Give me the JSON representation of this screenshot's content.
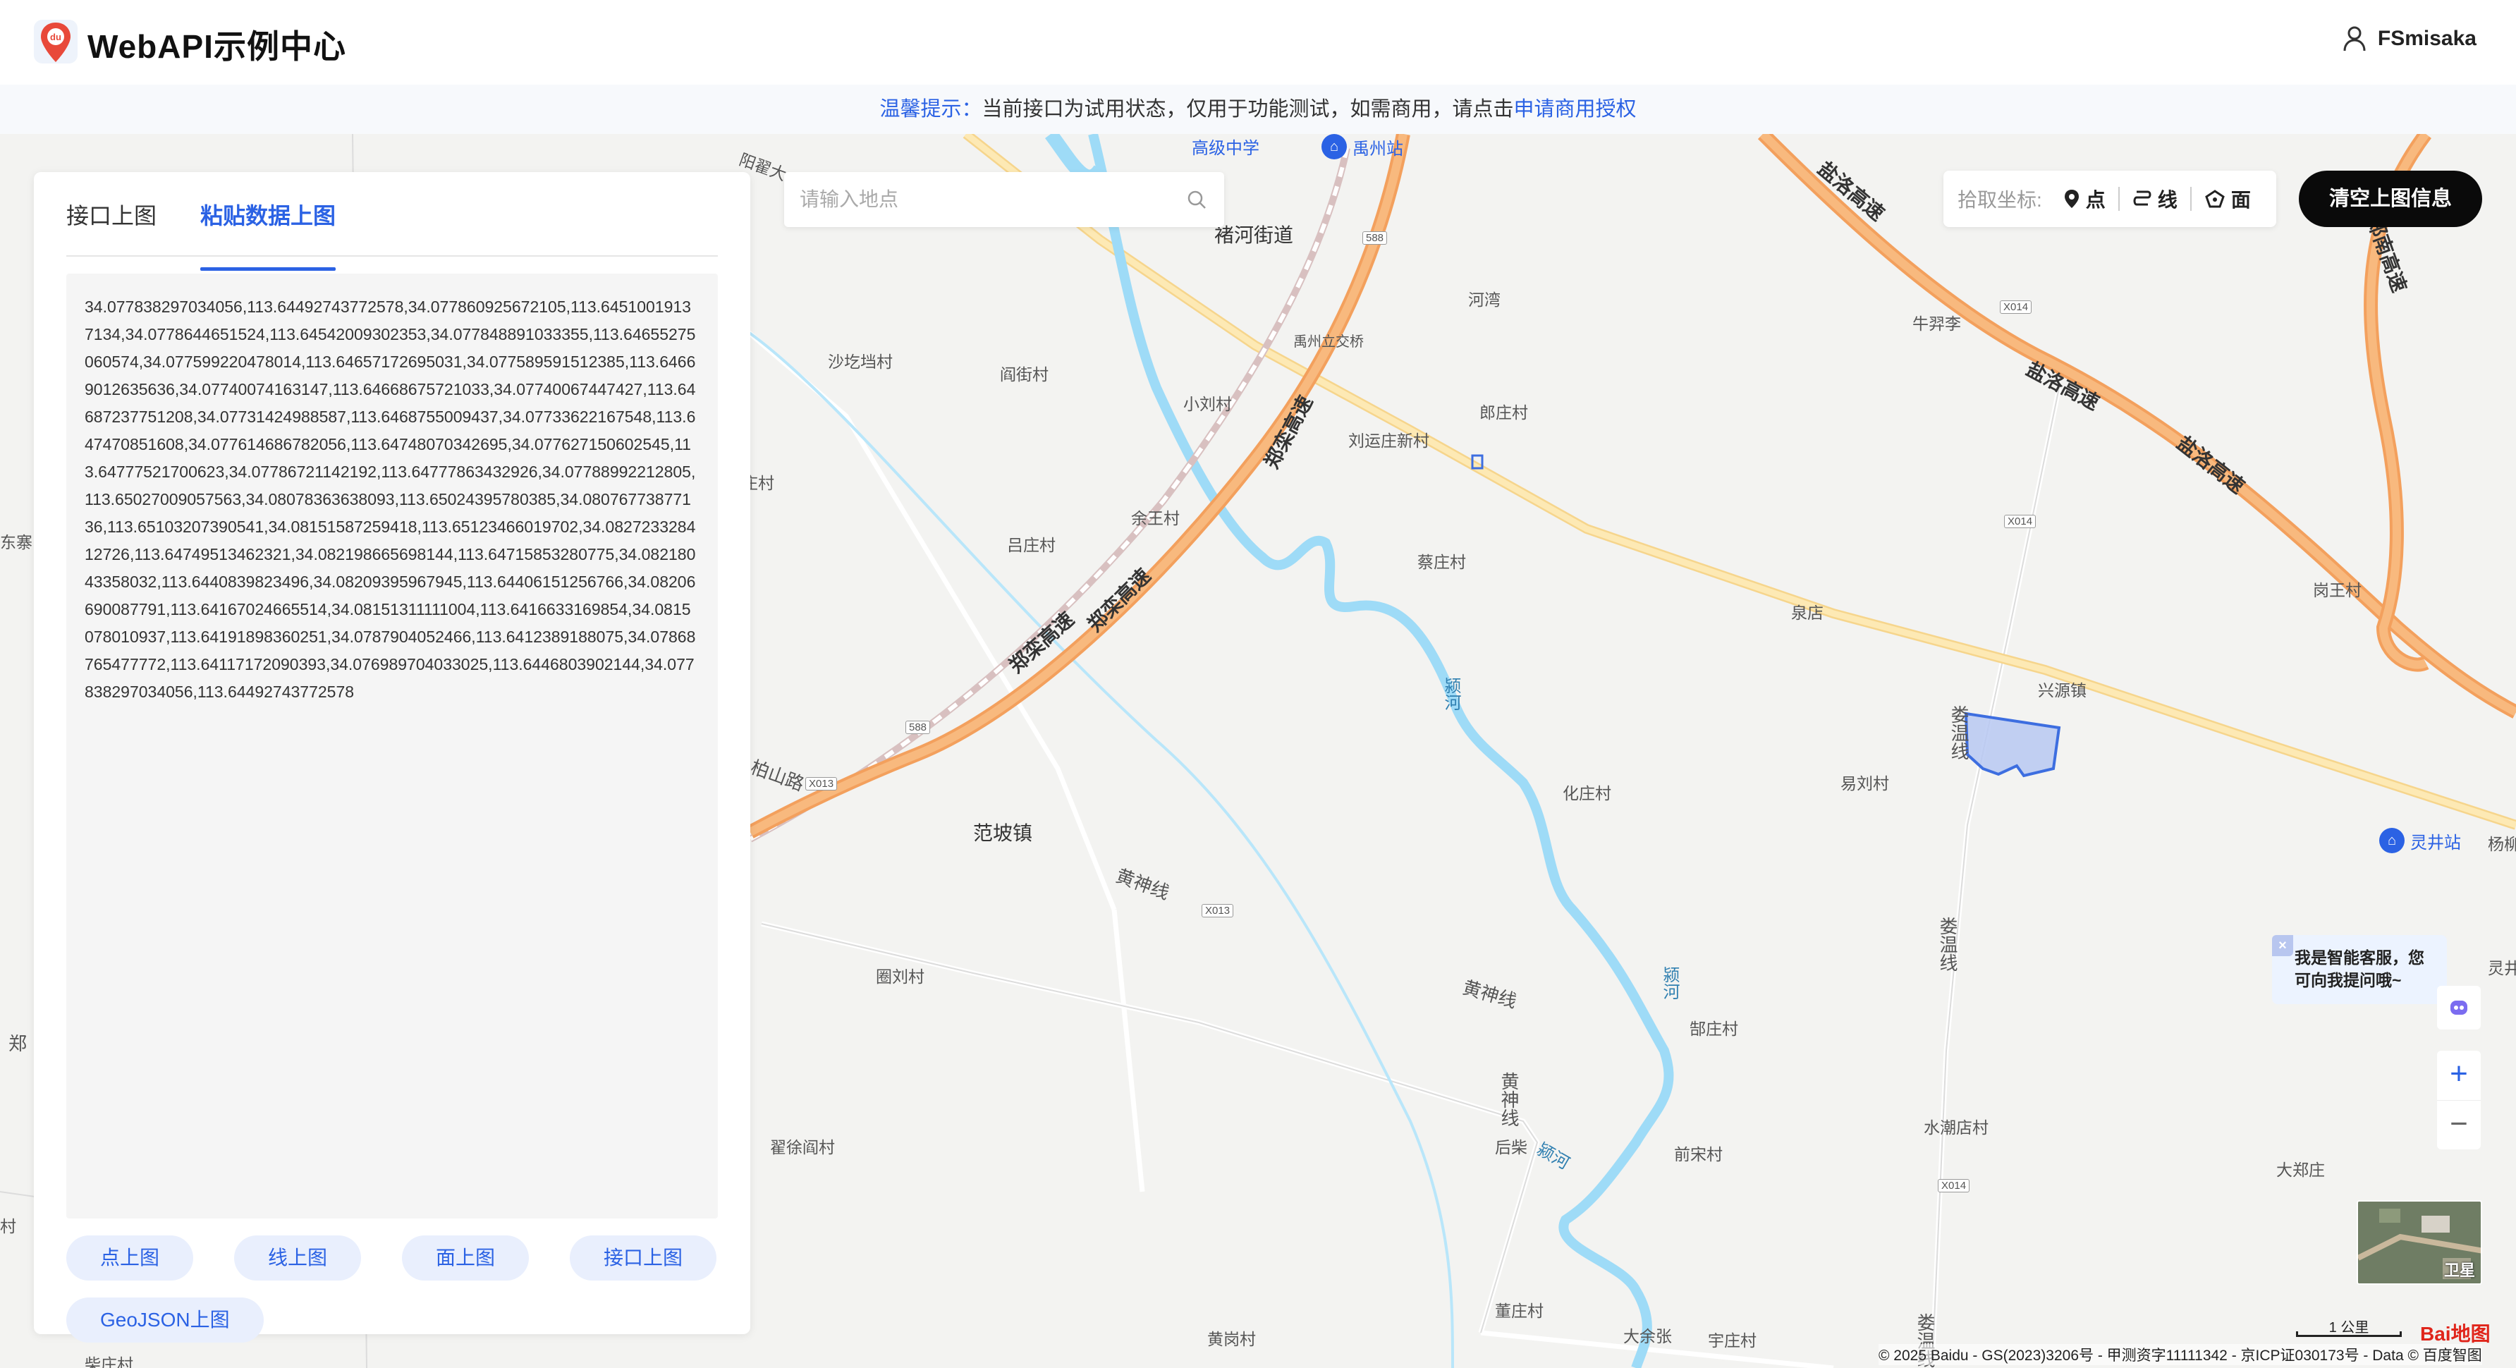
{
  "header": {
    "brand": "WebAPI示例中心",
    "user": "FSmisaka"
  },
  "notice": {
    "prefix": "温馨提示：",
    "text": "当前接口为试用状态，仅用于功能测试，如需商用，请点击",
    "link": "申请商用授权"
  },
  "panel": {
    "tabs": [
      {
        "label": "接口上图",
        "active": false
      },
      {
        "label": "粘贴数据上图",
        "active": true
      }
    ],
    "textarea_value": "34.077838297034056,113.64492743772578,34.077860925672105,113.64510019137134,34.0778644651524,113.64542009302353,34.077848891033355,113.64655275060574,34.077599220478014,113.64657172695031,34.077589591512385,113.64669012635636,34.07740074163147,113.64668675721033,34.07740067447427,113.64687237751208,34.07731424988587,113.6468755009437,34.07733622167548,113.647470851608,34.077614686782056,113.64748070342695,34.077627150602545,113.64777521700623,34.07786721142192,113.64777863432926,34.07788992212805,113.65027009057563,34.08078363638093,113.65024395780385,34.08076773877136,113.65103207390541,34.08151587259418,113.65123466019702,34.082723328412726,113.64749513462321,34.082198665698144,113.64715853280775,34.08218043358032,113.6440839823496,34.08209395967945,113.64406151256766,34.08206690087791,113.64167024665514,34.08151311111004,113.6416633169854,34.0815078010937,113.64191898360251,34.0787904052466,113.6412389188075,34.07868765477772,113.64117172090393,34.076989704033025,113.6446803902144,34.077838297034056,113.64492743772578",
    "buttons": [
      "点上图",
      "线上图",
      "面上图",
      "接口上图",
      "GeoJSON上图"
    ]
  },
  "search": {
    "placeholder": "请输入地点"
  },
  "toolbar": {
    "label": "拾取坐标:",
    "point": "点",
    "line": "线",
    "polygon": "面",
    "clear": "清空上图信息"
  },
  "chat": {
    "text": "我是智能客服，您可向我提问哦~"
  },
  "zoom": {
    "in": "+",
    "out": "−"
  },
  "satellite": {
    "label": "卫星"
  },
  "scale": {
    "label": "1 公里"
  },
  "copyright": "© 2025 Baidu - GS(2023)3206号 - 甲测资字11111342 - 京ICP证030173号 - Data © 百度智图",
  "baidu_logo": "Bai地图",
  "map": {
    "places": [
      {
        "id": "chuhe",
        "name": "褚河街道",
        "town": true
      },
      {
        "id": "hewan",
        "name": "河湾"
      },
      {
        "id": "yuzhoulijiao",
        "name": "禹州立交桥"
      },
      {
        "id": "niuyili",
        "name": "牛羿李"
      },
      {
        "id": "shaheda",
        "name": "沙圪垱村"
      },
      {
        "id": "yanjie",
        "name": "阎街村"
      },
      {
        "id": "xiaoliu",
        "name": "小刘村"
      },
      {
        "id": "langzhuang",
        "name": "郎庄村"
      },
      {
        "id": "liuyunzhuang",
        "name": "刘运庄新村"
      },
      {
        "id": "yuwang",
        "name": "余王村"
      },
      {
        "id": "lvzhuang",
        "name": "吕庄村"
      },
      {
        "id": "caizhuang",
        "name": "蔡庄村"
      },
      {
        "id": "quandian",
        "name": "泉店"
      },
      {
        "id": "gangwang",
        "name": "岗王村"
      },
      {
        "id": "xingyuan",
        "name": "兴源镇"
      },
      {
        "id": "yiliu",
        "name": "易刘村"
      },
      {
        "id": "huazhuang",
        "name": "化庄村"
      },
      {
        "id": "fanpo",
        "name": "范坡镇",
        "town": true
      },
      {
        "id": "quanliu",
        "name": "圈刘村"
      },
      {
        "id": "duzhuang",
        "name": "郜庄村"
      },
      {
        "id": "shuichaodian",
        "name": "水潮店村"
      },
      {
        "id": "zhaixuyan",
        "name": "翟徐阎村"
      },
      {
        "id": "houchai",
        "name": "后柴"
      },
      {
        "id": "qiansong",
        "name": "前宋村"
      },
      {
        "id": "dazhengzhuang",
        "name": "大郑庄"
      },
      {
        "id": "dongzhuang",
        "name": "董庄村"
      },
      {
        "id": "huanggang",
        "name": "黄岗村"
      },
      {
        "id": "dayuzhang",
        "name": "大余张"
      },
      {
        "id": "yuzhuang",
        "name": "宇庄村"
      },
      {
        "id": "yangliu",
        "name": "杨柳"
      },
      {
        "id": "zhuang1",
        "name": "庄村"
      },
      {
        "id": "cun1",
        "name": "村"
      },
      {
        "id": "chaizhuang",
        "name": "柴庄村"
      },
      {
        "id": "lingjing_r",
        "name": "灵井"
      },
      {
        "id": "dongzhai",
        "name": "东寨"
      },
      {
        "id": "yangdi",
        "name": "阳翟大"
      }
    ],
    "roads": [
      {
        "id": "zhengyao1",
        "name": "郑栾高速"
      },
      {
        "id": "zhengyao2",
        "name": "郑栾高速"
      },
      {
        "id": "zhengyao3",
        "name": "郑栾高速"
      },
      {
        "id": "yanluo1",
        "name": "盐洛高速"
      },
      {
        "id": "yanluo2",
        "name": "盐洛高速"
      },
      {
        "id": "yanluo3",
        "name": "盐洛高速"
      },
      {
        "id": "zhengnan",
        "name": "郑南高速"
      },
      {
        "id": "huangshen1",
        "name": "黄神线"
      },
      {
        "id": "huangshen2",
        "name": "黄神线"
      },
      {
        "id": "huangshen3",
        "name": "黄神线"
      },
      {
        "id": "louwen1",
        "name": "娄温线"
      },
      {
        "id": "louwen2",
        "name": "娄温线"
      },
      {
        "id": "louwen3",
        "name": "娄温线"
      },
      {
        "id": "baishan",
        "name": "柏山路"
      },
      {
        "id": "zheng_left",
        "name": "郑"
      }
    ],
    "rivers": [
      {
        "id": "ying1",
        "name": "颍河"
      },
      {
        "id": "ying2",
        "name": "颍河"
      },
      {
        "id": "ying3",
        "name": "颍河"
      }
    ],
    "shields": [
      {
        "id": "s588a",
        "name": "588"
      },
      {
        "id": "s588b",
        "name": "588"
      },
      {
        "id": "x013a",
        "name": "X013"
      },
      {
        "id": "x013b",
        "name": "X013"
      },
      {
        "id": "x014a",
        "name": "X014"
      },
      {
        "id": "x014b",
        "name": "X014"
      },
      {
        "id": "x014c",
        "name": "X014"
      }
    ],
    "stations": [
      {
        "id": "yuzhou",
        "name": "禹州站"
      },
      {
        "id": "lingjing",
        "name": "灵井站"
      },
      {
        "id": "gaoji",
        "name": "高级中学"
      }
    ],
    "colors": {
      "expressway": "#f5a862",
      "highway": "#fbe5a8",
      "river": "#8fd6f5",
      "polygon_fill": "#b7c8f2",
      "polygon_stroke": "#3d6ee0",
      "railway": "#c8a0a0"
    }
  }
}
